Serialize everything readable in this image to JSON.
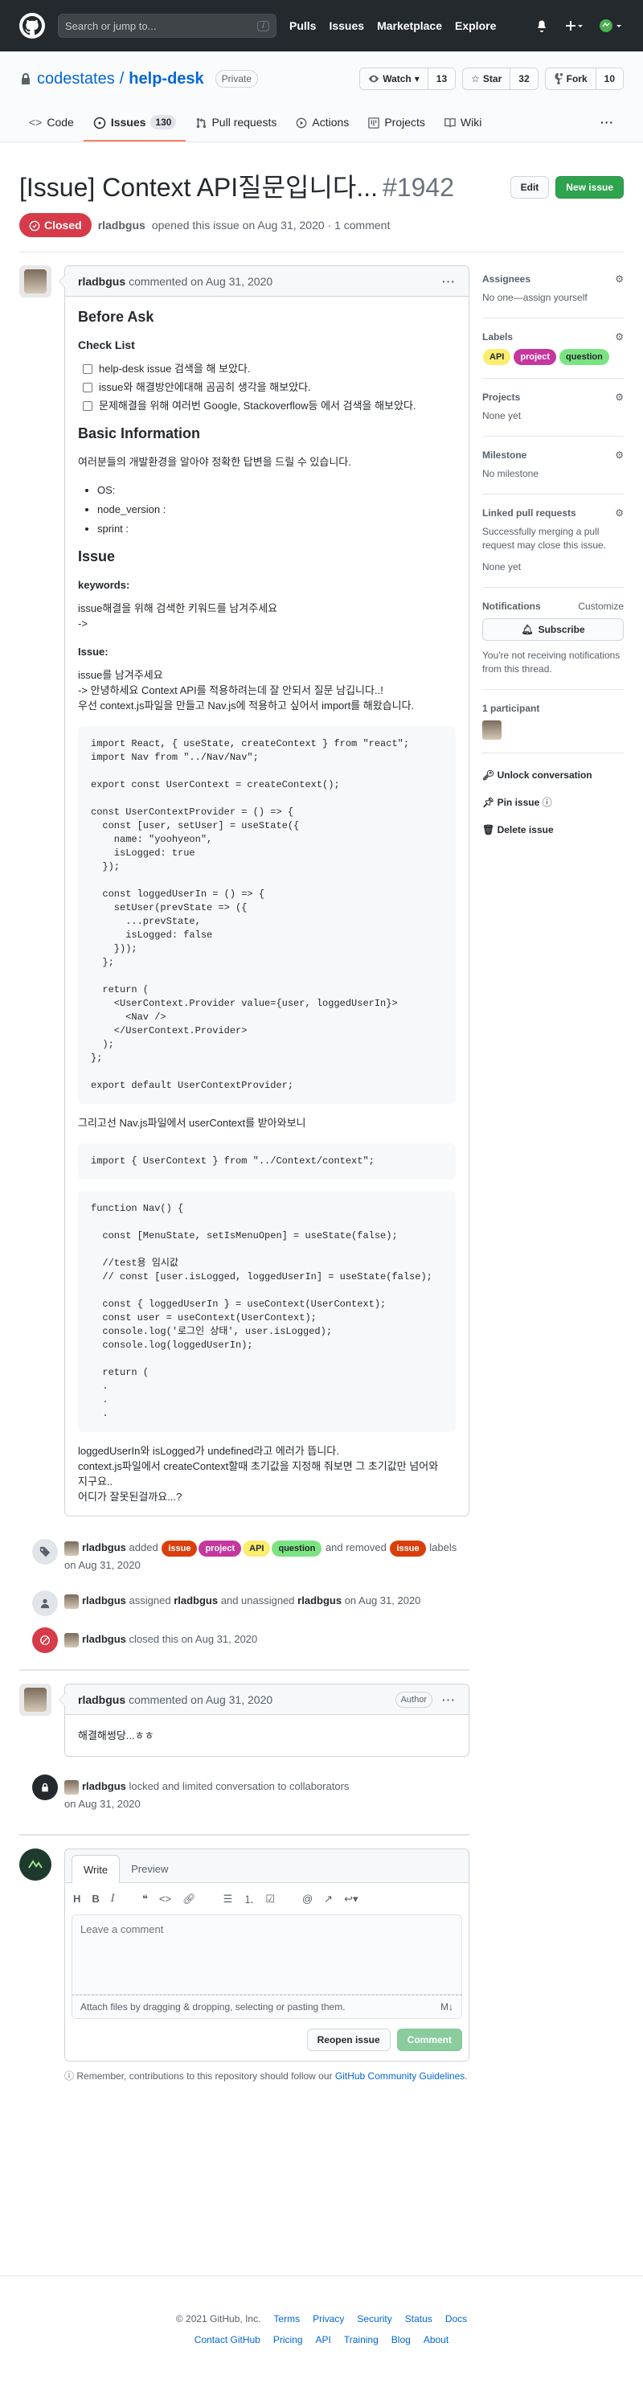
{
  "header": {
    "search_placeholder": "Search or jump to...",
    "search_hint": "/",
    "nav": [
      "Pulls",
      "Issues",
      "Marketplace",
      "Explore"
    ]
  },
  "repo": {
    "owner": "codestates",
    "name": "help-desk",
    "visibility": "Private",
    "watch_label": "Watch",
    "watch_count": "13",
    "star_label": "Star",
    "star_count": "32",
    "fork_label": "Fork",
    "fork_count": "10"
  },
  "tabs": [
    {
      "label": "Code"
    },
    {
      "label": "Issues",
      "count": "130"
    },
    {
      "label": "Pull requests"
    },
    {
      "label": "Actions"
    },
    {
      "label": "Projects"
    },
    {
      "label": "Wiki"
    }
  ],
  "issue": {
    "title": "[Issue] Context API질문입니다...",
    "number": "#1942",
    "edit_label": "Edit",
    "new_issue_label": "New issue",
    "state": "Closed",
    "author": "rladbgus",
    "opened_text": "opened this issue on Aug 31, 2020 · 1 comment"
  },
  "comment1": {
    "author": "rladbgus",
    "date_text": "commented on Aug 31, 2020",
    "h_before": "Before Ask",
    "h_checklist": "Check List",
    "tasks": [
      "help-desk issue 검색을 해 보았다.",
      "issue와 해결방안에대해 곰곰히 생각을 해보았다.",
      "문제해결을 위해 여러번 Google, Stackoverflow등 에서 검색을 해보았다."
    ],
    "h_basic": "Basic Information",
    "basic_intro": "여러분들의 개발환경을 알아야 정확한 답변을 드릴 수 있습니다.",
    "env": [
      "OS:",
      "node_version :",
      "sprint :"
    ],
    "h_issue": "Issue",
    "h_keywords": "keywords:",
    "keywords_line1": "issue해결을 위해 검색한 키워드를 남겨주세요",
    "keywords_line2": "->",
    "h_issue2": "Issue:",
    "issue_line1": "issue를 남겨주세요",
    "issue_line2": "-> 안녕하세요 Context API를 적용하려는데 잘 안되서 질문 남깁니다..!",
    "issue_line3": "우선 context.js파일을 만들고 Nav.js에 적용하고 싶어서 import를 해왔습니다.",
    "code1": "import React, { useState, createContext } from \"react\";\nimport Nav from \"../Nav/Nav\";\n\nexport const UserContext = createContext();\n\nconst UserContextProvider = () => {\n  const [user, setUser] = useState({\n    name: \"yoohyeon\",\n    isLogged: true\n  });\n\n  const loggedUserIn = () => {\n    setUser(prevState => ({\n      ...prevState,\n      isLogged: false\n    }));\n  };\n\n  return (\n    <UserContext.Provider value={user, loggedUserIn}>\n      <Nav />\n    </UserContext.Provider>\n  );\n};\n\nexport default UserContextProvider;",
    "mid_text": "그리고선 Nav.js파일에서 userContext를 받아와보니",
    "code2": "import { UserContext } from \"../Context/context\";",
    "code3": "function Nav() {\n\n  const [MenuState, setIsMenuOpen] = useState(false);\n\n  //test용 임시값\n  // const [user.isLogged, loggedUserIn] = useState(false);\n\n  const { loggedUserIn } = useContext(UserContext);\n  const user = useContext(UserContext);\n  console.log('로그인 상태', user.isLogged);\n  console.log(loggedUserIn);\n\n  return (\n  .\n  .\n  .",
    "end1": "loggedUserIn와 isLogged가 undefined라고 에러가 뜹니다.",
    "end2": "context.js파일에서 createContext할때 초기값을 지정해 줘보면 그 초기값만 넘어와",
    "end3": "지구요..",
    "end4": "어디가 잘못된걸까요...?"
  },
  "events": {
    "labels_actor": "rladbgus",
    "labels_added_text": "added",
    "labels_added": [
      {
        "name": "issue",
        "bg": "#d93f0b",
        "fg": "#ffffff"
      },
      {
        "name": "project",
        "bg": "#c5379c",
        "fg": "#ffffff"
      },
      {
        "name": "API",
        "bg": "#fbed6e",
        "fg": "#24292e"
      },
      {
        "name": "question",
        "bg": "#7be382",
        "fg": "#24292e"
      }
    ],
    "labels_removed_text": "and removed",
    "labels_removed": [
      {
        "name": "issue",
        "bg": "#d93f0b",
        "fg": "#ffffff"
      }
    ],
    "labels_tail": "labels on Aug 31, 2020",
    "assign_actor": "rladbgus",
    "assign_text1": "assigned",
    "assign_user": "rladbgus",
    "assign_text2": "and unassigned",
    "assign_user2": "rladbgus",
    "assign_date": "on Aug 31, 2020",
    "closed_actor": "rladbgus",
    "closed_text": "closed this on Aug 31, 2020",
    "locked_actor": "rladbgus",
    "locked_text": "locked and limited conversation to collaborators",
    "locked_date": "on Aug 31, 2020"
  },
  "comment2": {
    "author": "rladbgus",
    "date_text": "commented on Aug 31, 2020",
    "role": "Author",
    "body": "해결해썽당...ㅎㅎ"
  },
  "editor": {
    "tab_write": "Write",
    "tab_preview": "Preview",
    "placeholder": "Leave a comment",
    "attach_text": "Attach files by dragging & dropping, selecting or pasting them.",
    "reopen_label": "Reopen issue",
    "comment_label": "Comment",
    "note_prefix": "Remember, contributions to this repository should follow our",
    "note_link": "GitHub Community Guidelines",
    "note_suffix": "."
  },
  "sidebar": {
    "assignees_title": "Assignees",
    "assignees_value": "No one—assign yourself",
    "labels_title": "Labels",
    "labels": [
      {
        "name": "API",
        "bg": "#fbed6e",
        "fg": "#24292e"
      },
      {
        "name": "project",
        "bg": "#c5379c",
        "fg": "#ffffff"
      },
      {
        "name": "question",
        "bg": "#7be382",
        "fg": "#24292e"
      }
    ],
    "projects_title": "Projects",
    "projects_value": "None yet",
    "milestone_title": "Milestone",
    "milestone_value": "No milestone",
    "linked_title": "Linked pull requests",
    "linked_desc": "Successfully merging a pull request may close this issue.",
    "linked_value": "None yet",
    "notif_title": "Notifications",
    "notif_customize": "Customize",
    "subscribe_label": "Subscribe",
    "notif_desc": "You're not receiving notifications from this thread.",
    "participants_title": "1 participant",
    "unlock_label": "Unlock conversation",
    "pin_label": "Pin issue",
    "delete_label": "Delete issue"
  },
  "footer": {
    "copyright": "© 2021 GitHub, Inc.",
    "links_row1": [
      "Terms",
      "Privacy",
      "Security",
      "Status",
      "Docs"
    ],
    "links_row2": [
      "Contact GitHub",
      "Pricing",
      "API",
      "Training",
      "Blog",
      "About"
    ]
  }
}
